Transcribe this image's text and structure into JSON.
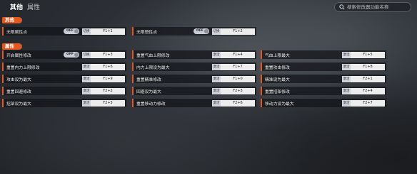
{
  "tabs": [
    {
      "label": "其他",
      "active": true
    },
    {
      "label": "属性",
      "active": false
    }
  ],
  "search": {
    "placeholder": "搜索修改器功能名称",
    "icon": "search-icon"
  },
  "sections": [
    {
      "title": "其他"
    },
    {
      "title": "属性"
    }
  ],
  "other_rows": [
    {
      "label": "无限属性点",
      "toggle": "OFF",
      "mode": "切换",
      "key": "F1+1"
    },
    {
      "label": "无限悟性点",
      "toggle": "OFF",
      "mode": "切换",
      "key": "F1+2"
    }
  ],
  "attr_rows": [
    {
      "label": "开启属性修改",
      "toggle": "OFF",
      "mode": "切换",
      "key": "F1+3"
    },
    {
      "label": "重置气血上限修改",
      "mode": "激活",
      "key": "F1+4"
    },
    {
      "label": "气血上限最大",
      "mode": "激活",
      "key": "F1+5"
    },
    {
      "label": "重置内力上限修改",
      "mode": "激活",
      "key": "F1+6"
    },
    {
      "label": "内力上限设为最大",
      "mode": "激活",
      "key": "F1+7"
    },
    {
      "label": "重置攻击修改",
      "mode": "激活",
      "key": "F1+8"
    },
    {
      "label": "攻击设为最大",
      "mode": "激活",
      "key": "F1+9"
    },
    {
      "label": "重置精准修改",
      "mode": "激活",
      "key": "F1+0"
    },
    {
      "label": "精准设为最大",
      "mode": "激活",
      "key": "F2+1"
    },
    {
      "label": "重置回避修改",
      "mode": "激活",
      "key": "F2+2"
    },
    {
      "label": "回避设为最大",
      "mode": "激活",
      "key": "F2+3"
    },
    {
      "label": "重置招架修改",
      "mode": "激活",
      "key": "F2+4"
    },
    {
      "label": "招架设为最大",
      "mode": "激活",
      "key": "F2+5"
    },
    {
      "label": "重置移动力修改",
      "mode": "激活",
      "key": "F2+6"
    },
    {
      "label": "移动力设为最大",
      "mode": "激活",
      "key": "F2+7"
    }
  ],
  "colors": {
    "accent": "#e4571f",
    "row_bg": "#14161a"
  }
}
